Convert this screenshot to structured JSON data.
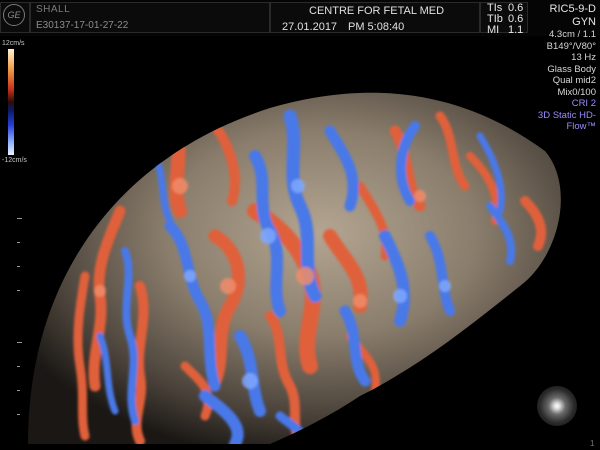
{
  "header": {
    "logo": "GE",
    "patient_name": "SHALL",
    "patient_id": "E30137-17-01-27-22",
    "hospital": "CENTRE FOR FETAL MED",
    "date": "27.01.2017",
    "time": "PM 5:08:40",
    "tis_label": "TIs",
    "tis_value": "0.6",
    "tib_label": "TIb",
    "tib_value": "0.6",
    "mi_label": "MI",
    "mi_value": "1.1",
    "probe": "RIC5-9-D",
    "preset": "GYN"
  },
  "params": {
    "depth": "4.3cm / 1.1",
    "angles": "B149°/V80°",
    "frequency": "13 Hz",
    "render_mode": "Glass Body",
    "quality": "Qual mid2",
    "mix": "Mix0/100",
    "cri": "CRI 2",
    "mode_line1": "3D Static HD-",
    "mode_line2": "Flow™"
  },
  "scale": {
    "top_label": "12cm/s",
    "bottom_label": "-12cm/s"
  },
  "footer": {
    "frame": "1"
  },
  "colors": {
    "flow_red": "#e0603a",
    "flow_blue": "#4a78e8",
    "tissue": "#8a7d6c",
    "param_blue": "#9a8cff"
  }
}
